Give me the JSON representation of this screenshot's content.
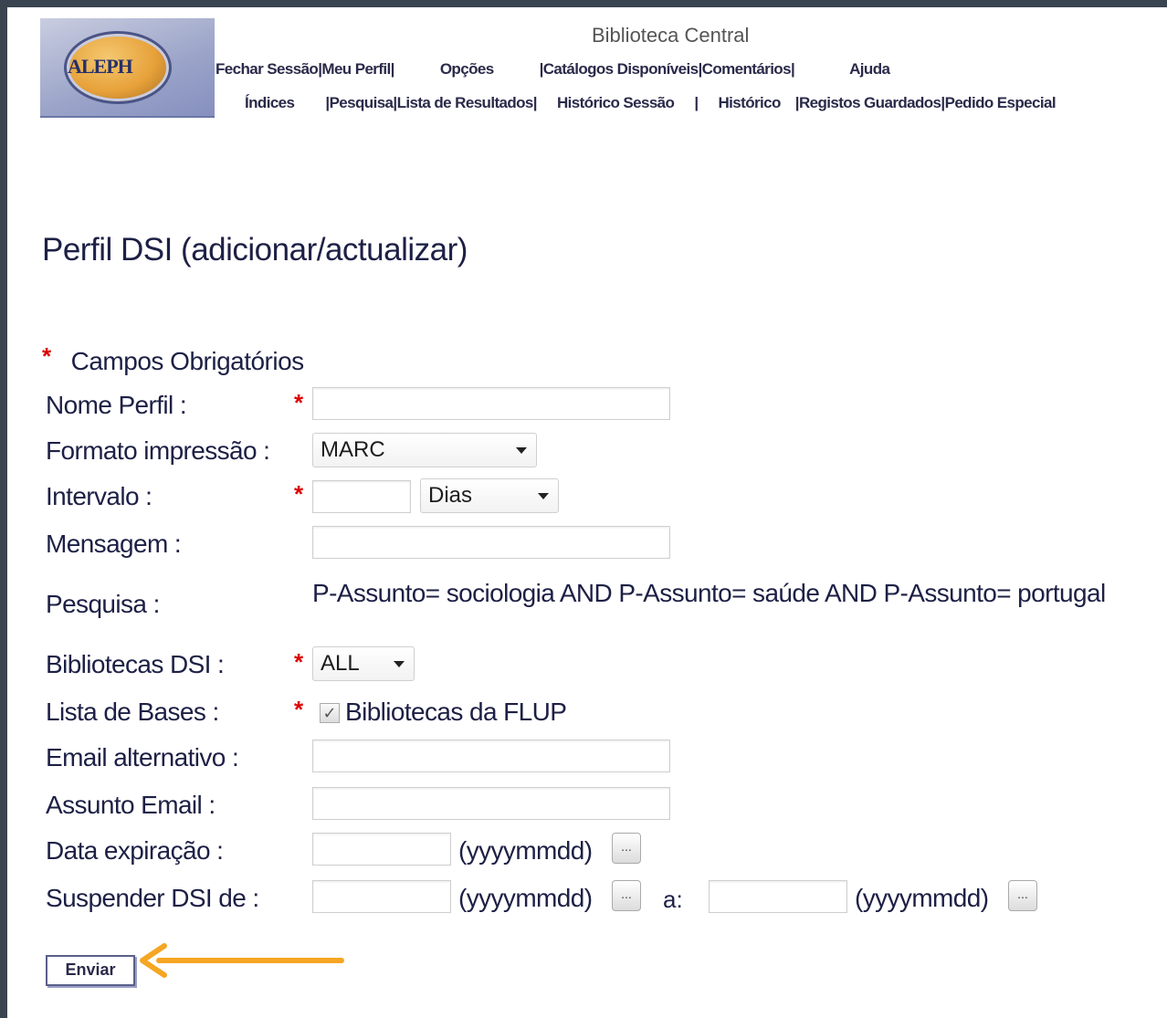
{
  "header": {
    "logo_text": "ALEPH",
    "title": "Biblioteca Central",
    "nav_row1": [
      {
        "label": "Fechar Sessão"
      },
      {
        "label": "Meu Perfil"
      },
      {
        "label": "Opções"
      },
      {
        "label": "Catálogos Disponíveis"
      },
      {
        "label": "Comentários"
      },
      {
        "label": "Ajuda"
      }
    ],
    "nav_row2": [
      {
        "label": "Índices"
      },
      {
        "label": "Pesquisa"
      },
      {
        "label": "Lista de Resultados"
      },
      {
        "label": "Histórico Sessão"
      },
      {
        "label": "Histórico"
      },
      {
        "label": "Registos Guardados"
      },
      {
        "label": "Pedido Especial"
      }
    ]
  },
  "page_title": "Perfil DSI (adicionar/actualizar)",
  "required_note": {
    "star": "*",
    "text": "Campos Obrigatórios"
  },
  "form": {
    "nome_perfil": {
      "label": "Nome Perfil :",
      "value": ""
    },
    "formato": {
      "label": "Formato impressão :",
      "selected": "MARC"
    },
    "intervalo": {
      "label": "Intervalo :",
      "value": "",
      "unit": "Dias"
    },
    "mensagem": {
      "label": "Mensagem :",
      "value": ""
    },
    "pesquisa": {
      "label": "Pesquisa :",
      "text": "P-Assunto= sociologia AND P-Assunto= saúde AND P-Assunto= portugal"
    },
    "bibliotecas": {
      "label": "Bibliotecas DSI :",
      "selected": "ALL"
    },
    "bases": {
      "label": "Lista de Bases :",
      "checkbox_label": "Bibliotecas da FLUP",
      "checked": true,
      "check_glyph": "✓"
    },
    "email_alt": {
      "label": "Email alternativo :",
      "value": ""
    },
    "assunto_email": {
      "label": "Assunto Email :",
      "value": ""
    },
    "data_expiracao": {
      "label": "Data expiração :",
      "value": "",
      "format": "(yyyymmdd)"
    },
    "suspender": {
      "label": "Suspender DSI de  :",
      "from": "",
      "format": "(yyyymmdd)",
      "to_label": "a:",
      "to": ""
    },
    "picker_glyph": "...",
    "star": "*"
  },
  "submit_label": "Enviar",
  "colors": {
    "annotation_arrow": "#f5a623",
    "required_star": "#dd0000",
    "text": "#1d2045"
  }
}
